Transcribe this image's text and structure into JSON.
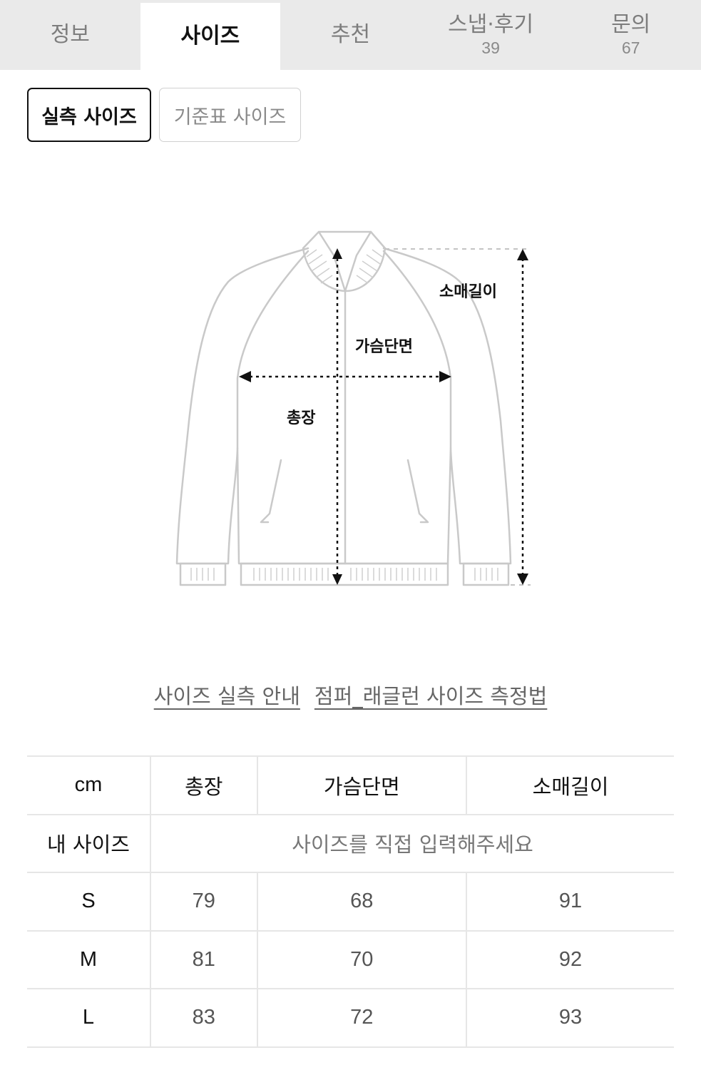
{
  "tabs": [
    {
      "label": "정보",
      "count": ""
    },
    {
      "label": "사이즈",
      "count": ""
    },
    {
      "label": "추천",
      "count": ""
    },
    {
      "label": "스냅·후기",
      "count": "39"
    },
    {
      "label": "문의",
      "count": "67"
    }
  ],
  "size_toggle": {
    "actual": "실측 사이즈",
    "standard": "기준표 사이즈"
  },
  "diagram": {
    "sleeve_length": "소매길이",
    "chest_width": "가슴단면",
    "total_length": "총장"
  },
  "guide_links": {
    "size_guide": "사이즈 실측 안내",
    "measure_method": "점퍼_래글런 사이즈 측정법"
  },
  "table": {
    "headers": [
      "cm",
      "총장",
      "가슴단면",
      "소매길이"
    ],
    "my_size": {
      "label": "내 사이즈",
      "placeholder": "사이즈를 직접 입력해주세요"
    },
    "rows": [
      {
        "size": "S",
        "values": [
          "79",
          "68",
          "91"
        ]
      },
      {
        "size": "M",
        "values": [
          "81",
          "70",
          "92"
        ]
      },
      {
        "size": "L",
        "values": [
          "83",
          "72",
          "93"
        ]
      }
    ]
  },
  "colors": {
    "tab_bar": "#eaeaea",
    "outline": "#cccccc",
    "text": "#111111",
    "muted": "#7d7d7d"
  }
}
